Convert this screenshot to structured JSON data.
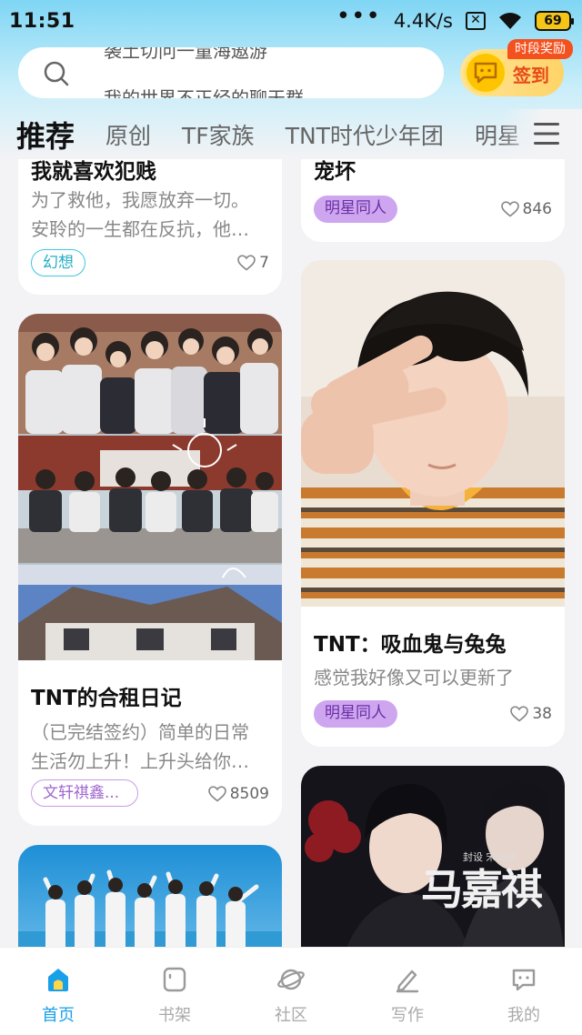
{
  "status_bar": {
    "time": "11:51",
    "dots": "•••",
    "net_speed": "4.4K/s",
    "battery": "69",
    "icons": [
      "sim-x-icon",
      "wifi-icon",
      "battery-icon"
    ]
  },
  "search": {
    "hint_top": "袭土切问一童海遨游",
    "hint_bottom": "我的世界不正经的聊天群",
    "icon": "search-icon"
  },
  "signin": {
    "label": "签到",
    "badge": "时段奖励",
    "icon": "coin-chat-icon"
  },
  "tabs": [
    {
      "label": "推荐",
      "active": true
    },
    {
      "label": "原创"
    },
    {
      "label": "TF家族"
    },
    {
      "label": "TNT时代少年团"
    },
    {
      "label": "明星"
    }
  ],
  "cards": {
    "left1": {
      "title": "我就喜欢犯贱",
      "desc1": "为了救他，我愿放弃一切。",
      "desc2": "安聆的一生都在反抗，他…",
      "tag": "幻想",
      "likes": "7"
    },
    "right1": {
      "title": "宠坏",
      "tag": "明星同人",
      "likes": "846"
    },
    "left2": {
      "title": "TNT的合租日记",
      "desc1": "（已完结签约）简单的日常",
      "desc2": "生活勿上升！上升头给你…",
      "tag": "文轩祺鑫...",
      "likes": "8509"
    },
    "right2": {
      "title": "TNT：吸血鬼与兔兔",
      "desc1": "感觉我好像又可以更新了",
      "tag": "明星同人",
      "likes": "38"
    },
    "right3": {
      "cover_text": "马嘉祺",
      "cover_small": "封设 宋屿桉"
    }
  },
  "bottom_nav": [
    {
      "label": "首页",
      "icon": "home-icon",
      "active": true
    },
    {
      "label": "书架",
      "icon": "bookshelf-icon"
    },
    {
      "label": "社区",
      "icon": "planet-icon"
    },
    {
      "label": "写作",
      "icon": "pen-icon"
    },
    {
      "label": "我的",
      "icon": "message-icon"
    }
  ],
  "colors": {
    "accent": "#1aa0e8",
    "tag_purple": "#cea6f0",
    "tag_cyan": "#3cc7dd",
    "signin_orange": "#e64a19"
  }
}
